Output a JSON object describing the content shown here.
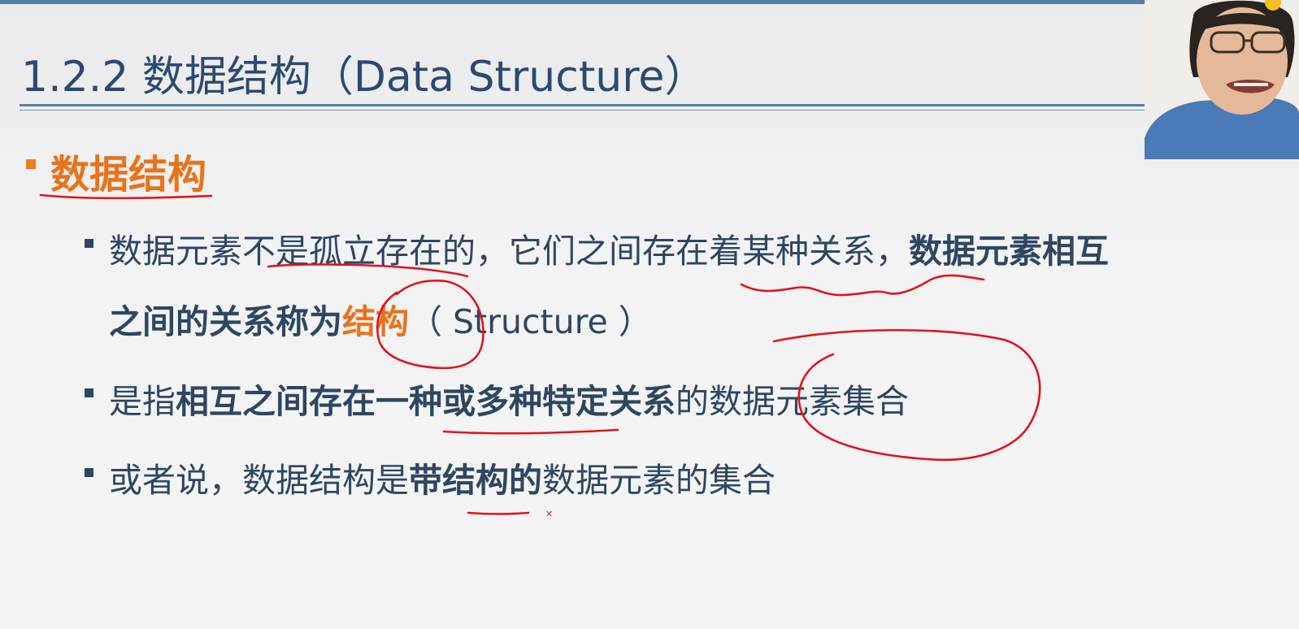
{
  "slide": {
    "title": "1.2.2 数据结构（Data Structure）",
    "heading": "数据结构",
    "bullets": [
      {
        "line1": {
          "plain": "数据元素不是孤立存在的，它们之间存在着某种关系，",
          "bold": "数据元素相互"
        },
        "line2": {
          "bold": "之间的关系称为",
          "orange": "结构",
          "plain": "（ Structure ）"
        }
      },
      {
        "plain_start": "是指",
        "bold": "相互之间存在一种或多种特定关系",
        "plain_end": "的数据元素集合"
      },
      {
        "plain_start": "或者说，数据结构是",
        "bold": "带结构的",
        "plain_end": "数据元素的集合"
      }
    ]
  },
  "colors": {
    "title": "#2c4a70",
    "accent": "#e8731c",
    "text": "#2f4661",
    "rule": "#5a7ea6",
    "ink": "#e0141e"
  }
}
